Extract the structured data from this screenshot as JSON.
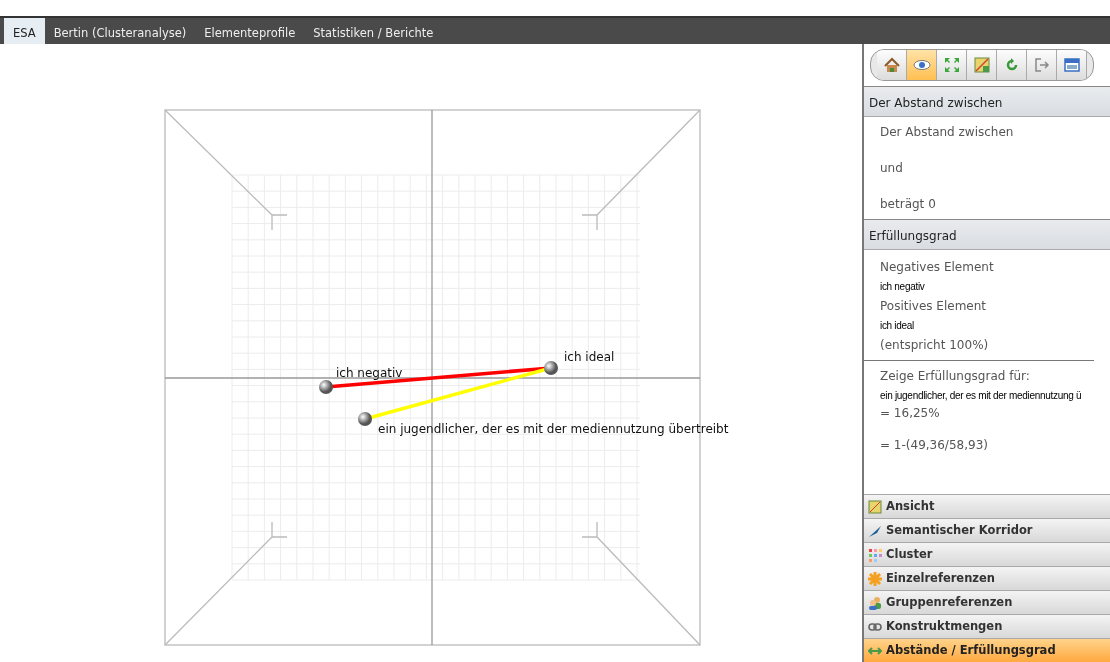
{
  "tabs": [
    {
      "label": "ESA",
      "selected": true
    },
    {
      "label": "Bertin (Clusteranalyse)",
      "selected": false
    },
    {
      "label": "Elementeprofile",
      "selected": false
    },
    {
      "label": "Statistiken / Berichte",
      "selected": false
    }
  ],
  "plot": {
    "elements": [
      {
        "label": "ich negativ"
      },
      {
        "label": "ich ideal"
      },
      {
        "label": "ein jugendlicher, der es mit der mediennutzung übertreibt"
      }
    ],
    "connections": [
      {
        "kind": "negative",
        "color": "#ff0000"
      },
      {
        "kind": "selected",
        "color": "#ffff00"
      }
    ]
  },
  "toolbar": [
    {
      "kind": "home",
      "selected": false
    },
    {
      "kind": "eye",
      "selected": true
    },
    {
      "kind": "expand",
      "selected": false
    },
    {
      "kind": "map",
      "selected": false
    },
    {
      "kind": "rotate",
      "selected": false
    },
    {
      "kind": "exit",
      "selected": false
    },
    {
      "kind": "window",
      "selected": false
    }
  ],
  "distance": {
    "title": "Der Abstand zwischen",
    "lines": [
      "Der Abstand zwischen",
      "und",
      "beträgt 0"
    ]
  },
  "fulfillment": {
    "title": "Erfüllungsgrad",
    "negative_label": "Negatives Element",
    "negative_value": "ich negativ",
    "positive_label": "Positives Element",
    "positive_value": "ich ideal",
    "positive_note": "(entspricht 100%)",
    "show_label": "Zeige Erfüllungsgrad für:",
    "show_value": "ein jugendlicher, der es mit der mediennutzung ü",
    "percent": "= 16,25%",
    "formula": "= 1-(49,36/58,93)"
  },
  "sections": [
    {
      "kind": "view",
      "label": "Ansicht",
      "selected": false
    },
    {
      "kind": "corridor",
      "label": "Semantischer Korridor",
      "selected": false
    },
    {
      "kind": "cluster",
      "label": "Cluster",
      "selected": false
    },
    {
      "kind": "single",
      "label": "Einzelreferenzen",
      "selected": false
    },
    {
      "kind": "group",
      "label": "Gruppenreferenzen",
      "selected": false
    },
    {
      "kind": "link",
      "label": "Konstruktmengen",
      "selected": false
    },
    {
      "kind": "distance",
      "label": "Abstände / Erfüllungsgrad",
      "selected": true
    }
  ]
}
